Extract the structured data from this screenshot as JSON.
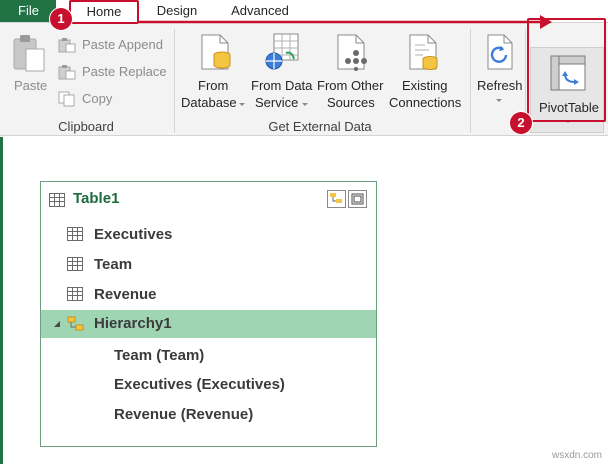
{
  "tabs": {
    "file": "File",
    "home": "Home",
    "design": "Design",
    "advanced": "Advanced"
  },
  "ribbon": {
    "clipboard": {
      "paste": "Paste",
      "paste_append": "Paste Append",
      "paste_replace": "Paste Replace",
      "copy": "Copy",
      "group_label": "Clipboard"
    },
    "external_data": {
      "from_database_1": "From",
      "from_database_2": "Database",
      "from_data_service_1": "From Data",
      "from_data_service_2": "Service",
      "from_other_sources_1": "From Other",
      "from_other_sources_2": "Sources",
      "existing_connections_1": "Existing",
      "existing_connections_2": "Connections",
      "group_label": "Get External Data"
    },
    "refresh": "Refresh",
    "pivottable": "PivotTable"
  },
  "annotations": {
    "badge_1": "1",
    "badge_2": "2",
    "color": "#c8102e"
  },
  "table_card": {
    "title": "Table1",
    "fields": [
      "Executives",
      "Team",
      "Revenue"
    ],
    "hierarchy": {
      "label": "Hierarchy1",
      "children": [
        "Team (Team)",
        "Executives (Executives)",
        "Revenue (Revenue)"
      ]
    }
  },
  "colors": {
    "accent_green": "#217346",
    "selected_row": "#9fd5b3",
    "title_green": "#1e6b3c"
  },
  "watermark": "wsxdn.com"
}
